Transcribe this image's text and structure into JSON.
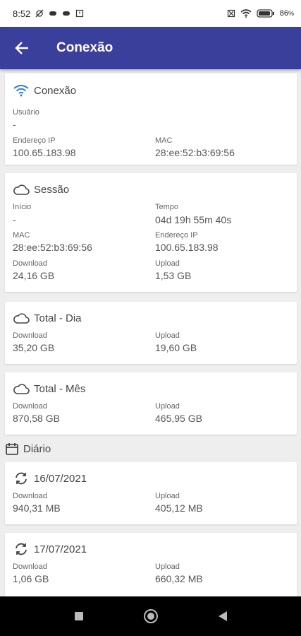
{
  "status_bar": {
    "time": "8:52",
    "battery": "86"
  },
  "app_bar": {
    "title": "Conexão"
  },
  "conexao_card": {
    "title": "Conexão",
    "usuario_label": "Usuário",
    "usuario_value": "-",
    "ip_label": "Endereço IP",
    "ip_value": "100.65.183.98",
    "mac_label": "MAC",
    "mac_value": "28:ee:52:b3:69:56"
  },
  "sessao_card": {
    "title": "Sessão",
    "inicio_label": "Início",
    "inicio_value": "-",
    "tempo_label": "Tempo",
    "tempo_value": "04d 19h 55m 40s",
    "mac_label": "MAC",
    "mac_value": "28:ee:52:b3:69:56",
    "ip_label": "Endereço IP",
    "ip_value": "100.65.183.98",
    "download_label": "Download",
    "download_value": "24,16 GB",
    "upload_label": "Upload",
    "upload_value": "1,53 GB"
  },
  "total_dia_card": {
    "title": "Total - Dia",
    "download_label": "Download",
    "download_value": "35,20 GB",
    "upload_label": "Upload",
    "upload_value": "19,60 GB"
  },
  "total_mes_card": {
    "title": "Total - Mês",
    "download_label": "Download",
    "download_value": "870,58 GB",
    "upload_label": "Upload",
    "upload_value": "465,95 GB"
  },
  "diario_section": {
    "title": "Diário"
  },
  "daily_entries": [
    {
      "date": "16/07/2021",
      "download_label": "Download",
      "download_value": "940,31 MB",
      "upload_label": "Upload",
      "upload_value": "405,12 MB"
    },
    {
      "date": "17/07/2021",
      "download_label": "Download",
      "download_value": "1,06 GB",
      "upload_label": "Upload",
      "upload_value": "660,32 MB"
    }
  ],
  "colors": {
    "app_bar": "#3b3f9c",
    "wifi_icon": "#2a7fd6",
    "background": "#eeeeee",
    "card": "#ffffff"
  },
  "icons": {
    "back": "arrow-left-icon",
    "conexao": "wifi-icon",
    "sessao": "cloud-icon",
    "totals": "cloud-icon",
    "diario": "calendar-icon",
    "daily": "sync-icon"
  }
}
